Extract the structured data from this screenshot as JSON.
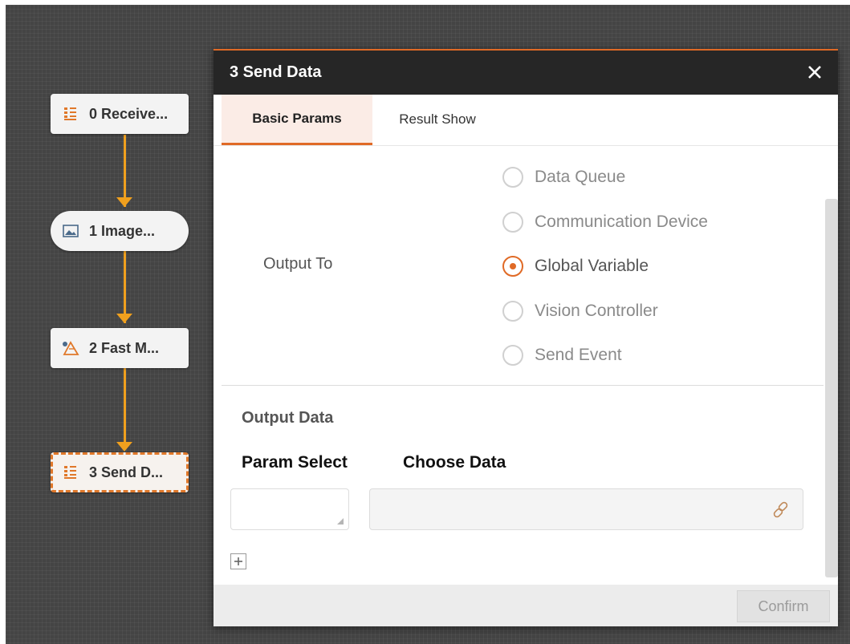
{
  "flow": {
    "nodes": [
      {
        "label": "0 Receive...",
        "icon": "receive-data-icon"
      },
      {
        "label": "1 Image...",
        "icon": "image-icon"
      },
      {
        "label": "2 Fast M...",
        "icon": "fast-match-icon"
      },
      {
        "label": "3 Send D...",
        "icon": "send-data-icon"
      }
    ],
    "colors": {
      "link": "#f0a01e",
      "selected_border": "#e0782a"
    }
  },
  "dialog": {
    "title": "3 Send Data",
    "close_icon": "close-icon",
    "tabs": [
      {
        "label": "Basic Params",
        "active": true
      },
      {
        "label": "Result Show",
        "active": false
      }
    ],
    "output_to": {
      "label": "Output To",
      "options": [
        {
          "label": "Data Queue",
          "checked": false
        },
        {
          "label": "Communication Device",
          "checked": false
        },
        {
          "label": "Global Variable",
          "checked": true
        },
        {
          "label": "Vision Controller",
          "checked": false
        },
        {
          "label": "Send Event",
          "checked": false
        }
      ]
    },
    "output_data": {
      "title": "Output Data",
      "param_select_header": "Param Select",
      "choose_data_header": "Choose Data",
      "param_select_value": "",
      "choose_data_value": "",
      "link_icon": "link-icon",
      "add_icon": "plus-icon"
    },
    "confirm_label": "Confirm",
    "colors": {
      "accent": "#e06a26",
      "header_bg": "#262626",
      "active_tab_bg": "#fbece6"
    }
  }
}
